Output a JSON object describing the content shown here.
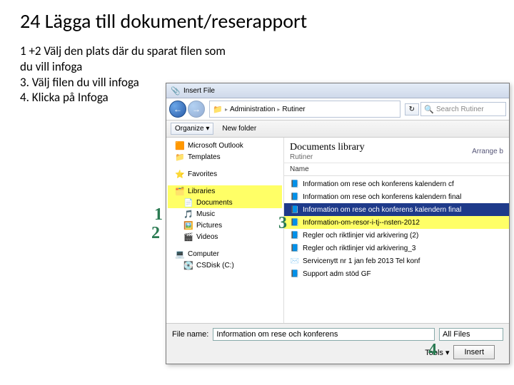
{
  "slide": {
    "title": "24 Lägga till dokument/reserapport",
    "instr1": "1 +2 Välj den plats där du sparat filen som du vill infoga",
    "instr3": "3. Välj filen du vill infoga",
    "instr4": "4. Klicka på Infoga"
  },
  "dialog": {
    "title": "Insert File",
    "breadcrumb": {
      "a": "Administration",
      "b": "Rutiner"
    },
    "search_placeholder": "Search Rutiner",
    "refresh": "↻",
    "toolbar": {
      "organize": "Organize ▾",
      "newfolder": "New folder"
    },
    "tree": {
      "outlook": "Microsoft Outlook",
      "templates": "Templates",
      "favorites": "Favorites",
      "libraries": "Libraries",
      "documents": "Documents",
      "music": "Music",
      "pictures": "Pictures",
      "videos": "Videos",
      "computer": "Computer",
      "cdrive": "CSDisk (C:)"
    },
    "list": {
      "header_title": "Documents library",
      "header_sub": "Rutiner",
      "arrange": "Arrange b",
      "col_name": "Name",
      "rows": [
        "Information om rese och konferens kalendern cf",
        "Information om rese och konferens kalendern final",
        "Information om rese och konferens kalendern final",
        "Information-om-resor-i-tj--nsten-2012",
        "Regler och riktlinjer vid arkivering (2)",
        "Regler och riktlinjer vid arkivering_3",
        "Servicenytt nr 1 jan feb 2013 Tel konf",
        "Support adm stöd GF"
      ]
    },
    "footer": {
      "label_filename": "File name:",
      "filename_value": "Information om rese och konferens",
      "filter": "All Files",
      "tools": "Tools ▾",
      "insert": "Insert"
    }
  },
  "annotations": {
    "n1": "1",
    "n2": "2",
    "n3": "3",
    "n4": "4"
  }
}
